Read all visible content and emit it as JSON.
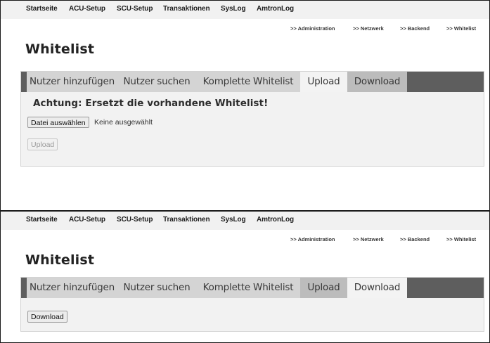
{
  "nav": {
    "items": [
      "Startseite",
      "ACU-Setup",
      "SCU-Setup",
      "Transaktionen",
      "SysLog",
      "AmtronLog"
    ]
  },
  "breadcrumb": ">> Administration",
  "breadcrumb_items": [
    ">> Administration",
    ">> Netzwerk",
    ">> Backend",
    ">> Whitelist"
  ],
  "page_title": "Whitelist",
  "tabs": [
    {
      "label": "Nutzer hinzufügen"
    },
    {
      "label": "Nutzer suchen"
    },
    {
      "label": "Komplette Whitelist"
    },
    {
      "label": "Upload"
    },
    {
      "label": "Download"
    }
  ],
  "upload_view": {
    "active_tab": "Upload",
    "warning": "Achtung: Ersetzt die vorhandene Whitelist!",
    "choose_file_label": "Datei auswählen",
    "no_file_text": "Keine ausgewählt",
    "upload_button": "Upload"
  },
  "download_view": {
    "active_tab": "Download",
    "download_button": "Download"
  }
}
